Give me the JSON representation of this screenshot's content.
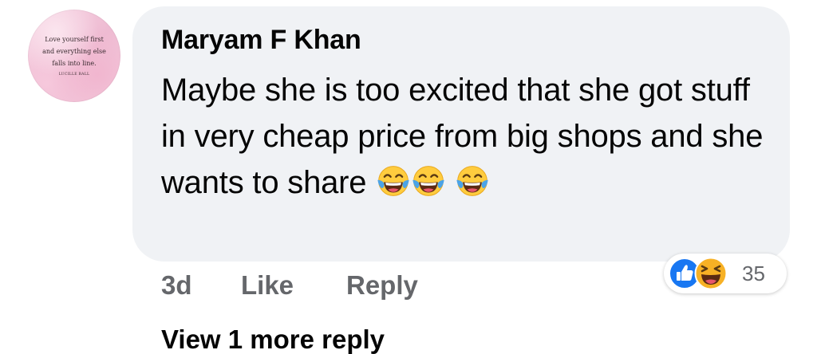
{
  "comment": {
    "author": "Maryam F Khan",
    "text": "Maybe she is too excited that she got stuff in very cheap price from big shops and she wants to share",
    "emojis": [
      "face-with-tears-of-joy",
      "face-with-tears-of-joy",
      "face-with-tears-of-joy"
    ],
    "avatar": {
      "quote_lines": [
        "Love yourself first",
        "and everything else",
        "falls into line."
      ],
      "quote_author": "LUCILLE BALL"
    }
  },
  "actions": {
    "timestamp": "3d",
    "like_label": "Like",
    "reply_label": "Reply"
  },
  "reactions": {
    "types": [
      "like",
      "haha"
    ],
    "count": "35",
    "colors": {
      "like": "#1877f2",
      "haha": "#f7b125"
    }
  },
  "replies": {
    "view_more_label": "View 1 more reply"
  },
  "colors": {
    "bubble": "#f0f2f5",
    "primary_text": "#050505",
    "secondary_text": "#65676b"
  }
}
